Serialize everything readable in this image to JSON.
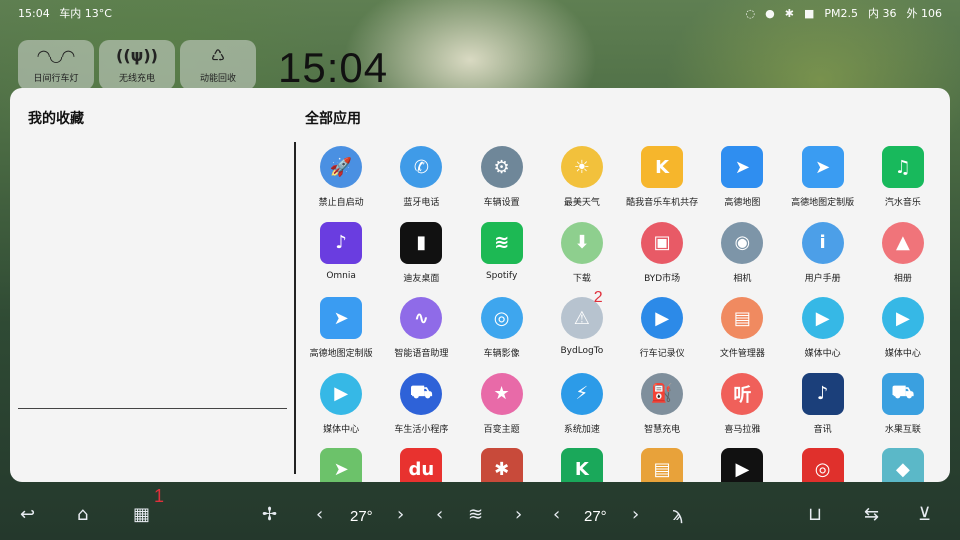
{
  "status": {
    "time": "15:04",
    "in_temp": "车内 13°C",
    "pm": "PM2.5",
    "in_value": "内 36",
    "out_value": "外 106",
    "icons": [
      "wifi-icon",
      "lock-icon",
      "person-icon",
      "camera-icon"
    ]
  },
  "tiles": [
    {
      "icon": "glasses-light-icon",
      "glyph": "◠◡◠",
      "label": "日间行车灯"
    },
    {
      "icon": "wireless-charging-icon",
      "glyph": "((ψ))",
      "label": "无线充电"
    },
    {
      "icon": "energy-recovery-icon",
      "glyph": "♺",
      "label": "动能回收"
    }
  ],
  "clock": "15:04",
  "favorites": {
    "title": "我的收藏"
  },
  "apps_title": "全部应用",
  "apps": [
    {
      "label": "禁止自启动",
      "icon": "rocket-icon",
      "glyph": "🚀",
      "bg": "#4a90e2"
    },
    {
      "label": "蓝牙电话",
      "icon": "phone-icon",
      "glyph": "✆",
      "bg": "#3f9be8"
    },
    {
      "label": "车辆设置",
      "icon": "gear-icon",
      "glyph": "⚙",
      "bg": "#6f8799"
    },
    {
      "label": "最美天气",
      "icon": "weather-icon",
      "glyph": "☀",
      "bg": "#f2c13c"
    },
    {
      "label": "酷我音乐车机共存",
      "icon": "kuwo-icon",
      "glyph": "K",
      "bg": "#f6b62c",
      "sq": true
    },
    {
      "label": "高德地图",
      "icon": "amap-icon",
      "glyph": "➤",
      "bg": "#2f8ef0",
      "sq": true
    },
    {
      "label": "高德地图定制版",
      "icon": "amap-custom-icon",
      "glyph": "➤",
      "bg": "#3a9cf2",
      "sq": true
    },
    {
      "label": "汽水音乐",
      "icon": "soda-music-icon",
      "glyph": "♫",
      "bg": "#18b95c",
      "sq": true
    },
    {
      "label": "Omnia",
      "icon": "omnia-icon",
      "glyph": "♪",
      "bg": "#6a3de0",
      "sq": true
    },
    {
      "label": "迪友桌面",
      "icon": "diyou-icon",
      "glyph": "▮",
      "bg": "#111111",
      "sq": true
    },
    {
      "label": "Spotify",
      "icon": "spotify-icon",
      "glyph": "≋",
      "bg": "#1db954",
      "sq": true
    },
    {
      "label": "下载",
      "icon": "download-icon",
      "glyph": "⬇",
      "bg": "#8ecf8e"
    },
    {
      "label": "BYD市场",
      "icon": "store-icon",
      "glyph": "▣",
      "bg": "#e85a66"
    },
    {
      "label": "相机",
      "icon": "camera-app-icon",
      "glyph": "◉",
      "bg": "#7d95a8"
    },
    {
      "label": "用户手册",
      "icon": "manual-icon",
      "glyph": "i",
      "bg": "#4c9fe8"
    },
    {
      "label": "相册",
      "icon": "gallery-icon",
      "glyph": "▲",
      "bg": "#f0747a"
    },
    {
      "label": "高德地图定制版",
      "icon": "amap-custom-icon",
      "glyph": "➤",
      "bg": "#3a9cf2",
      "sq": true
    },
    {
      "label": "智能语音助理",
      "icon": "voice-icon",
      "glyph": "∿",
      "bg": "#8f6be8"
    },
    {
      "label": "车辆影像",
      "icon": "car-view-icon",
      "glyph": "◎",
      "bg": "#3ea6ee"
    },
    {
      "label": "BydLogTo",
      "icon": "warning-icon",
      "glyph": "⚠",
      "bg": "#b7c3cf",
      "badge": "2"
    },
    {
      "label": "行车记录仪",
      "icon": "dashcam-icon",
      "glyph": "▶",
      "bg": "#2c8ae8"
    },
    {
      "label": "文件管理器",
      "icon": "folder-icon",
      "glyph": "▤",
      "bg": "#f08a60"
    },
    {
      "label": "媒体中心",
      "icon": "media-icon",
      "glyph": "▶",
      "bg": "#36b8e6"
    },
    {
      "label": "媒体中心",
      "icon": "media-icon",
      "glyph": "▶",
      "bg": "#36b8e6"
    },
    {
      "label": "媒体中心",
      "icon": "media-icon",
      "glyph": "▶",
      "bg": "#36b8e6"
    },
    {
      "label": "车生活小程序",
      "icon": "car-life-icon",
      "glyph": "⛟",
      "bg": "#2e62d8"
    },
    {
      "label": "百变主题",
      "icon": "theme-icon",
      "glyph": "★",
      "bg": "#e86aa8"
    },
    {
      "label": "系统加速",
      "icon": "speedup-icon",
      "glyph": "⚡",
      "bg": "#2c9be8"
    },
    {
      "label": "智慧充电",
      "icon": "charging-icon",
      "glyph": "⛽",
      "bg": "#7f8f9c"
    },
    {
      "label": "喜马拉雅",
      "icon": "ximalaya-icon",
      "glyph": "听",
      "bg": "#f0605a"
    },
    {
      "label": "音讯",
      "icon": "audio-icon",
      "glyph": "♪",
      "bg": "#1b3f7a",
      "sq": true
    },
    {
      "label": "水果互联",
      "icon": "fruit-connect-icon",
      "glyph": "⛟",
      "bg": "#3aa0e0",
      "sq": true
    },
    {
      "label": "",
      "icon": "map-app-icon",
      "glyph": "➤",
      "bg": "#6cc26a",
      "sq": true
    },
    {
      "label": "",
      "icon": "du-icon",
      "glyph": "du",
      "bg": "#e8322f",
      "sq": true
    },
    {
      "label": "",
      "icon": "bug-icon",
      "glyph": "✱",
      "bg": "#c84a3a",
      "sq": true
    },
    {
      "label": "",
      "icon": "k-app-icon",
      "glyph": "K",
      "bg": "#1aa85a",
      "sq": true
    },
    {
      "label": "",
      "icon": "file-app-icon",
      "glyph": "▤",
      "bg": "#e8a23a",
      "sq": true
    },
    {
      "label": "",
      "icon": "player-icon",
      "glyph": "▶",
      "bg": "#111111",
      "sq": true
    },
    {
      "label": "",
      "icon": "netease-icon",
      "glyph": "◎",
      "bg": "#e0302c",
      "sq": true
    },
    {
      "label": "",
      "icon": "cube-icon",
      "glyph": "◆",
      "bg": "#5bb8c8",
      "sq": true
    }
  ],
  "dock": {
    "temp_left": "27°",
    "temp_right": "27°",
    "apps_badge": "1"
  }
}
